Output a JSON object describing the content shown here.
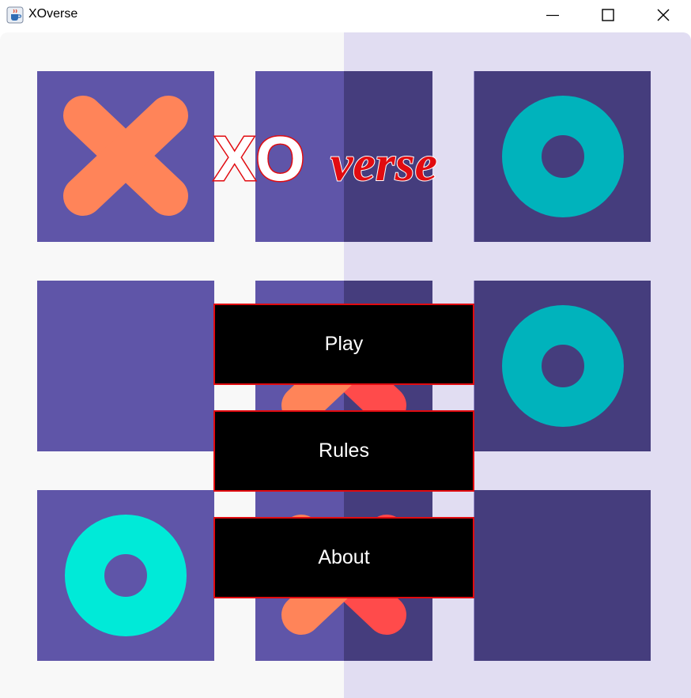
{
  "window": {
    "title": "XOverse",
    "icon": "java-coffee-icon",
    "controls": [
      "minimize-icon",
      "maximize-icon",
      "close-icon"
    ]
  },
  "logo": {
    "part1": "XO",
    "part2": "verse"
  },
  "menu": {
    "play_label": "Play",
    "rules_label": "Rules",
    "about_label": "About"
  },
  "board": {
    "cells": [
      {
        "row": 1,
        "col": 1,
        "mark": "X"
      },
      {
        "row": 1,
        "col": 2,
        "mark": ""
      },
      {
        "row": 1,
        "col": 3,
        "mark": "O"
      },
      {
        "row": 2,
        "col": 1,
        "mark": ""
      },
      {
        "row": 2,
        "col": 2,
        "mark": "X"
      },
      {
        "row": 2,
        "col": 3,
        "mark": "O"
      },
      {
        "row": 3,
        "col": 1,
        "mark": "O"
      },
      {
        "row": 3,
        "col": 2,
        "mark": "X"
      },
      {
        "row": 3,
        "col": 3,
        "mark": ""
      }
    ]
  },
  "colors": {
    "accent_red": "#e10b10",
    "x_mark": "#ff8459",
    "x_mark_right": "#ff4b4b",
    "o_mark": "#00b3bc",
    "o_mark_bright": "#00ead8",
    "cell_light": "#5f55a8",
    "cell_dark": "#453d7d"
  }
}
